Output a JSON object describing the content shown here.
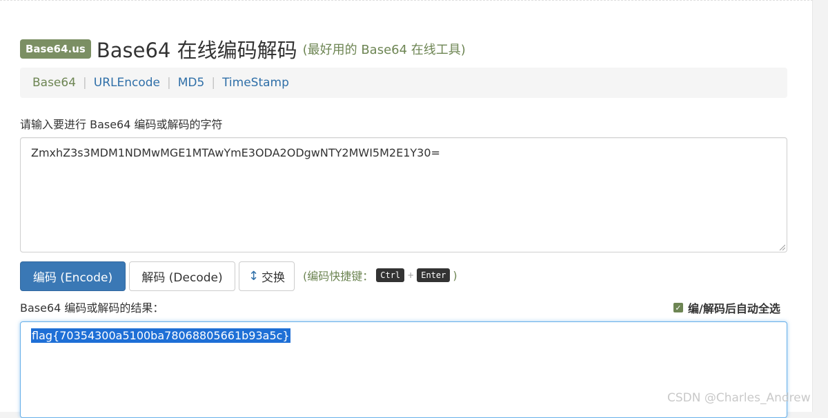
{
  "header": {
    "brand": "Base64.us",
    "title": "Base64 在线编码解码",
    "subtitle": "(最好用的 Base64 在线工具)"
  },
  "nav": {
    "items": [
      {
        "label": "Base64",
        "active": true
      },
      {
        "label": "URLEncode",
        "active": false
      },
      {
        "label": "MD5",
        "active": false
      },
      {
        "label": "TimeStamp",
        "active": false
      }
    ],
    "separator": "|"
  },
  "input": {
    "label": "请输入要进行 Base64 编码或解码的字符",
    "value": "ZmxhZ3s3MDM1NDMwMGE1MTAwYmE3ODA2ODgwNTY2MWI5M2E1Y30="
  },
  "actions": {
    "encode_label": "编码 (Encode)",
    "decode_label": "解码 (Decode)",
    "swap_icon": "up-down-arrow-icon",
    "swap_label": "交换"
  },
  "shortcut_hint": {
    "prefix": "(编码快捷键：",
    "key1": "Ctrl",
    "plus": "+",
    "key2": "Enter",
    "suffix": ")"
  },
  "output": {
    "label": "Base64 编码或解码的结果：",
    "auto_select_label": "编/解码后自动全选",
    "auto_select_checked": true,
    "value": "flag{70354300a5100ba78068805661b93a5c}"
  },
  "watermark": "CSDN @Charles_Andrew",
  "colors": {
    "brand_green": "#7b8f63",
    "accent_green": "#6d8553",
    "link_blue": "#2f6fa8",
    "primary_button": "#3a78b5",
    "selection": "#1e6fd6"
  }
}
